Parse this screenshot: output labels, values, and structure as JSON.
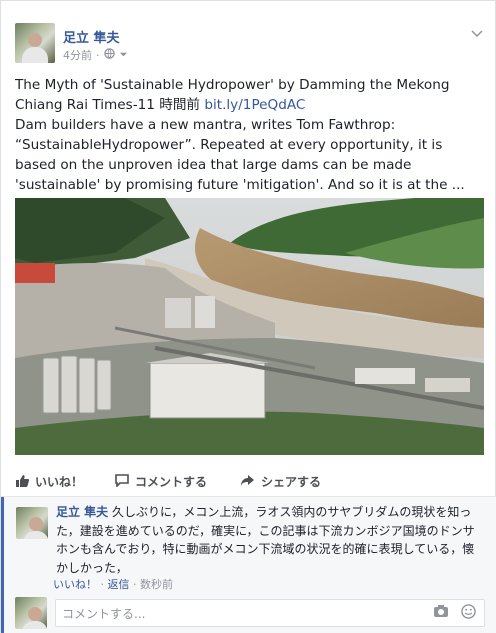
{
  "post": {
    "author": "足立 隼夫",
    "time": "4分前",
    "privacy_sep": "·",
    "title_line": "The Myth of 'Sustainable Hydropower' by Damming the Mekong",
    "source_line": "Chiang Rai Times-11 時間前 ",
    "link": "bit.ly/1PeQdAC",
    "body": "Dam builders have a new mantra, writes Tom Fawthrop: “SustainableHydropower”. Repeated at every opportunity, it is based on the unproven idea that large dams can be made 'sustainable' by promising future 'mitigation'. And so it is at the ..."
  },
  "actions": {
    "like": "いいね！",
    "comment": "コメントする",
    "share": "シェアする"
  },
  "comment": {
    "author": "足立 隼夫",
    "text": " 久しぶりに，メコン上流，ラオス領内のサヤブリダムの現状を知った，建設を進めているのだ，確実に，この記事は下流カンボジア国境のドンサホンも含んでおり，特に動画がメコン下流域の状況を的確に表現している，懐かしかった，",
    "like": "いいね！",
    "sep": " · ",
    "reply": "返信",
    "time": "数秒前"
  },
  "reply_box": {
    "placeholder": "コメントする..."
  },
  "colors": {
    "link": "#365899",
    "accent": "#4267b2"
  }
}
